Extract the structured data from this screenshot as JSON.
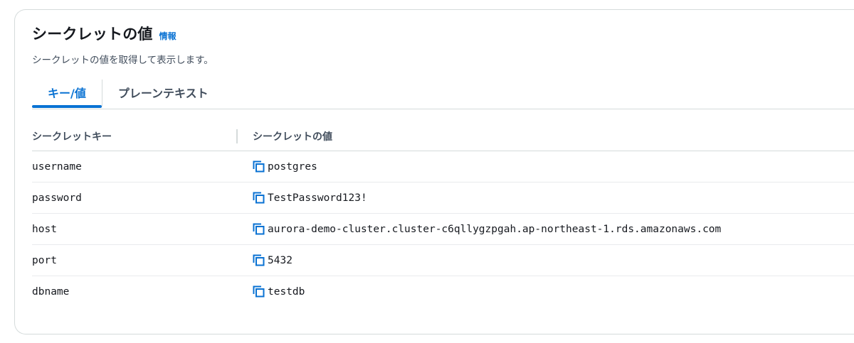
{
  "header": {
    "title": "シークレットの値",
    "info_link": "情報",
    "description": "シークレットの値を取得して表示します。"
  },
  "tabs": [
    {
      "label": "キー/値",
      "active": true
    },
    {
      "label": "プレーンテキスト",
      "active": false
    }
  ],
  "table": {
    "columns": [
      "シークレットキー",
      "シークレットの値"
    ],
    "rows": [
      {
        "key": "username",
        "value": "postgres"
      },
      {
        "key": "password",
        "value": "TestPassword123!"
      },
      {
        "key": "host",
        "value": "aurora-demo-cluster.cluster-c6qllygzpgah.ap-northeast-1.rds.amazonaws.com"
      },
      {
        "key": "port",
        "value": "5432"
      },
      {
        "key": "dbname",
        "value": "testdb"
      }
    ]
  },
  "icons": {
    "copy": "copy-icon"
  },
  "colors": {
    "accent": "#0972d3",
    "text": "#16191f",
    "border": "#d5dbdb"
  }
}
